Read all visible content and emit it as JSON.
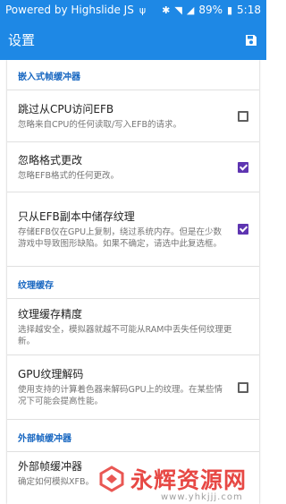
{
  "statusbar": {
    "left_text": "Powered by Highslide JS",
    "battery": "89%",
    "time": "5:18"
  },
  "toolbar": {
    "title": "设置"
  },
  "sections": [
    {
      "header": "嵌入式帧缓冲器",
      "items": [
        {
          "title": "跳过从CPU访问EFB",
          "summary": "忽略来自CPU的任何读取/写入EFB的请求。",
          "checked": false
        },
        {
          "title": "忽略格式更改",
          "summary": "忽略EFB格式的任何更改。",
          "checked": true
        },
        {
          "title": "只从EFB副本中储存纹理",
          "summary": "存储EFB仅在GPU上复制，绕过系统内存。但是在少数游戏中导致图形缺陷。如果不确定，请选中此复选框。",
          "checked": true
        }
      ]
    },
    {
      "header": "纹理缓存",
      "items": [
        {
          "title": "纹理缓存精度",
          "summary": "选择越安全，模拟器就越不可能从RAM中丢失任何纹理更新。"
        },
        {
          "title": "GPU纹理解码",
          "summary": "使用支持的计算着色器来解码GPU上的纹理。在某些情况下可能会提高性能。",
          "checked": false
        }
      ]
    },
    {
      "header": "外部帧缓冲器",
      "items": [
        {
          "title": "外部帧缓冲器",
          "summary": "确定如何模拟XFB。"
        }
      ]
    }
  ],
  "watermark": {
    "text": "永辉资源网",
    "url": "www.yhkjjj.com"
  },
  "colors": {
    "primary": "#1e88e5",
    "accent": "#5e35b1",
    "section_header": "#1565c0"
  }
}
